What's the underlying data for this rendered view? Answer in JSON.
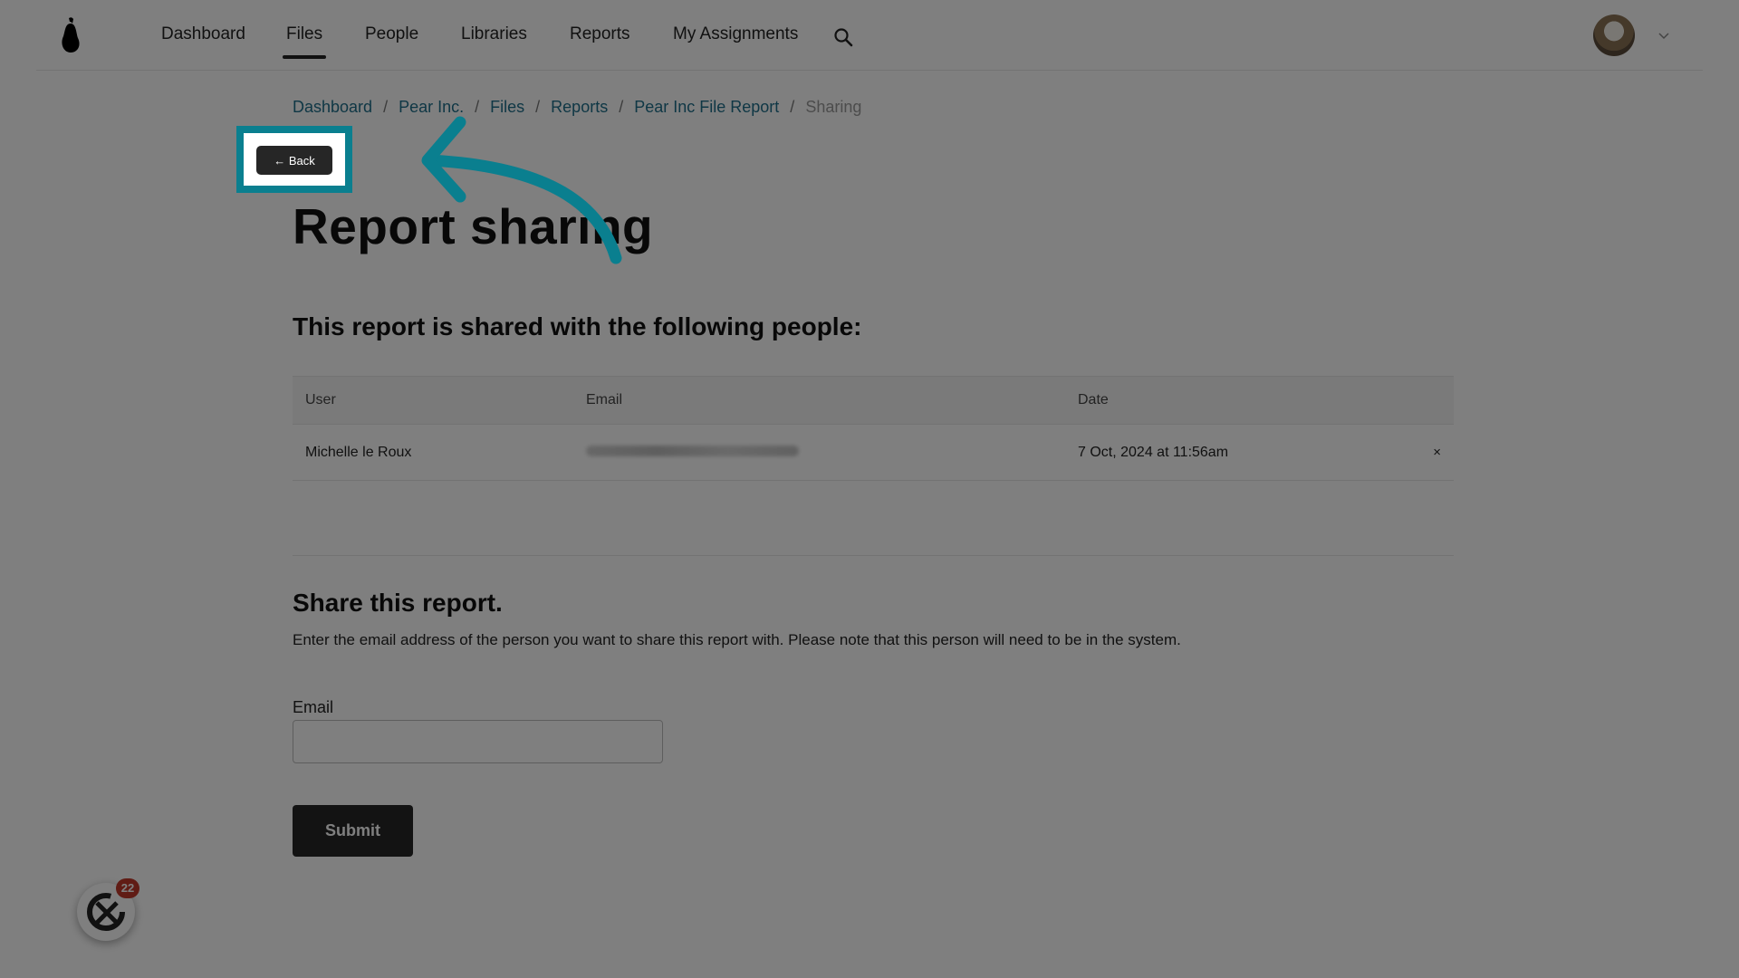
{
  "nav": {
    "items": [
      {
        "label": "Dashboard",
        "active": false
      },
      {
        "label": "Files",
        "active": true
      },
      {
        "label": "People",
        "active": false
      },
      {
        "label": "Libraries",
        "active": false
      },
      {
        "label": "Reports",
        "active": false
      },
      {
        "label": "My Assignments",
        "active": false
      }
    ],
    "search_icon": "search-icon",
    "avatar_icon": "user-avatar",
    "chevron_icon": "chevron-down-icon"
  },
  "breadcrumb": {
    "items": [
      "Dashboard",
      "Pear Inc.",
      "Files",
      "Reports",
      "Pear Inc File Report"
    ],
    "current": "Sharing",
    "separator": "/"
  },
  "back_button": {
    "label": "← Back"
  },
  "page": {
    "title": "Report sharing"
  },
  "shared": {
    "heading": "This report is shared with the following people:",
    "columns": [
      "User",
      "Email",
      "Date"
    ],
    "rows": [
      {
        "user": "Michelle le Roux",
        "email_redacted": true,
        "date": "7 Oct, 2024 at 11:56am",
        "remove_label": "×"
      }
    ]
  },
  "share_form": {
    "heading": "Share this report.",
    "description": "Enter the email address of the person you want to share this report with. Please note that this person will need to be in the system.",
    "email_label": "Email",
    "email_value": "",
    "submit_label": "Submit"
  },
  "widget": {
    "badge_count": "22"
  },
  "colors": {
    "highlight": "#0a7f8f",
    "link": "#1f6f8b",
    "button_dark": "#262626",
    "badge": "#c0392b"
  }
}
